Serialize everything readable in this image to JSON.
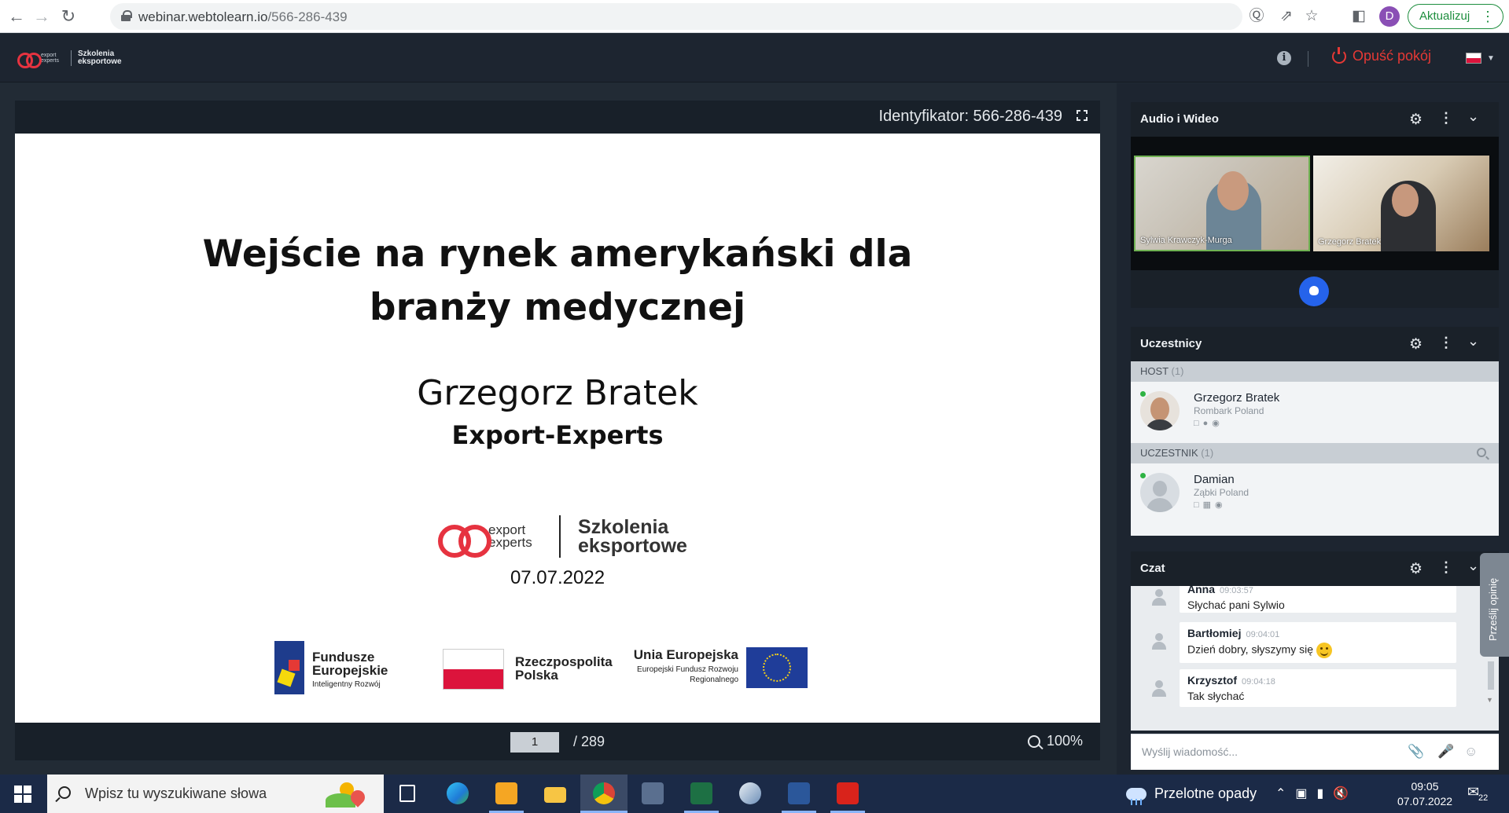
{
  "browser": {
    "url_host": "webinar.webtolearn.io",
    "url_path": "/566-286-439",
    "profile_initial": "D",
    "update_label": "Aktualizuj"
  },
  "app": {
    "logo_small": "export experts",
    "logo_brand": "Szkolenia eksportowe",
    "leave_label": "Opuść pokój"
  },
  "presentation": {
    "identifier": "Identyfikator: 566-286-439",
    "page_current": "1",
    "page_total": "/ 289",
    "zoom": "100%"
  },
  "slide": {
    "title_line1": "Wejście na rynek amerykański dla",
    "title_line2": "branży medycznej",
    "speaker": "Grzegorz Bratek",
    "company": "Export-Experts",
    "logo_ex": "export experts",
    "logo_sz": "Szkolenia eksportowe",
    "date": "07.07.2022",
    "fe_title": "Fundusze Europejskie",
    "fe_sub": "Inteligentny Rozwój",
    "pl_title": "Rzeczpospolita Polska",
    "eu_title": "Unia Europejska",
    "eu_sub": "Europejski Fundusz Rozwoju Regionalnego"
  },
  "av": {
    "title": "Audio i Wideo",
    "video1_name": "Sylwia Krawczyk-Murga",
    "video2_name": "Grzegorz Bratek"
  },
  "participants": {
    "title": "Uczestnicy",
    "host_group": "HOST",
    "host_count": "(1)",
    "host_name": "Grzegorz Bratek",
    "host_loc": "Rombark Poland",
    "guest_group": "UCZESTNIK",
    "guest_count": "(1)",
    "guest_name": "Damian",
    "guest_loc": "Ząbki Poland"
  },
  "chat": {
    "title": "Czat",
    "messages": [
      {
        "who": "Anna",
        "time": "09:03:57",
        "text": "Słychać pani Sylwio"
      },
      {
        "who": "Bartłomiej",
        "time": "09:04:01",
        "text": "Dzień dobry, słyszymy się"
      },
      {
        "who": "Krzysztof",
        "time": "09:04:18",
        "text": "Tak słychać"
      }
    ],
    "input_placeholder": "Wyślij wiadomość...",
    "feedback": "Prześlij opinię"
  },
  "taskbar": {
    "search_placeholder": "Wpisz tu wyszukiwane słowa",
    "weather": "Przelotne opady",
    "time": "09:05",
    "date": "07.07.2022",
    "notif_count": "22"
  },
  "colors": {
    "accent_red": "#e53935",
    "brand_red": "#e63340",
    "online_green": "#2fb344",
    "raise_blue": "#2563eb"
  }
}
